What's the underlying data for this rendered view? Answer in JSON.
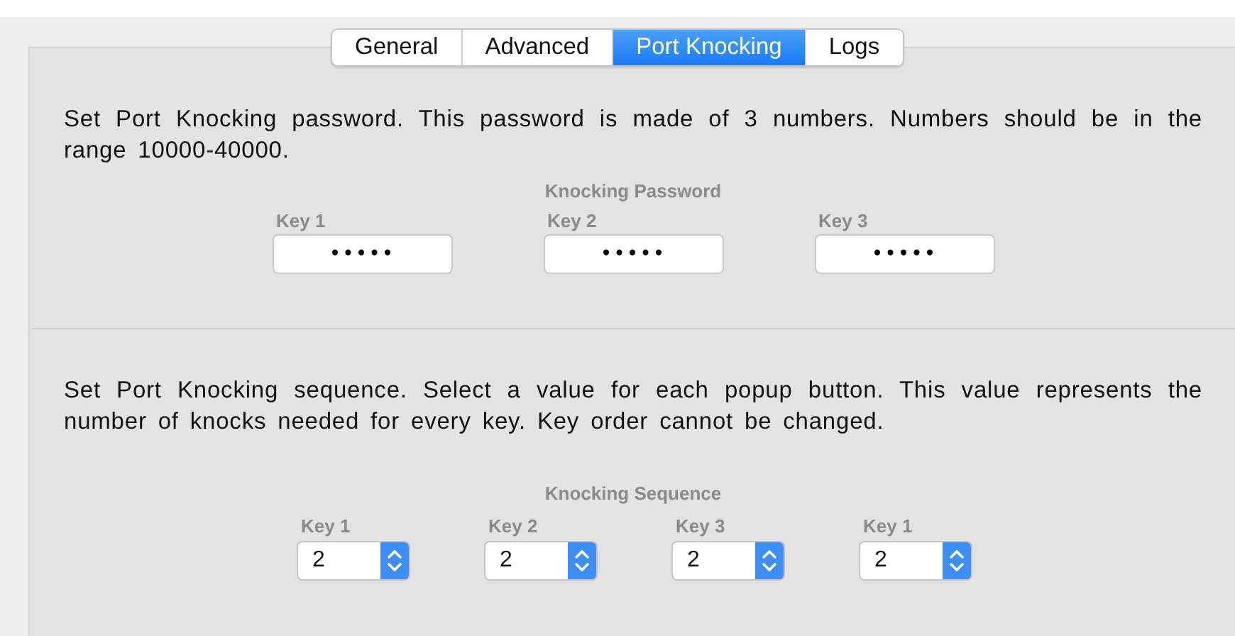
{
  "tabs": [
    {
      "label": "General",
      "selected": false
    },
    {
      "label": "Advanced",
      "selected": false
    },
    {
      "label": "Port Knocking",
      "selected": true
    },
    {
      "label": "Logs",
      "selected": false
    }
  ],
  "password_section": {
    "description": "Set Port Knocking password. This password is made of 3 numbers. Numbers should be in the range 10000-40000.",
    "heading": "Knocking Password",
    "fields": [
      {
        "label": "Key 1",
        "value": "•••••"
      },
      {
        "label": "Key 2",
        "value": "•••••"
      },
      {
        "label": "Key 3",
        "value": "•••••"
      }
    ]
  },
  "sequence_section": {
    "description": "Set Port Knocking sequence. Select a value for each popup button. This value represents the number of knocks needed for every key. Key order cannot be changed.",
    "heading": "Knocking Sequence",
    "popups": [
      {
        "label": "Key 1",
        "value": "2"
      },
      {
        "label": "Key 2",
        "value": "2"
      },
      {
        "label": "Key 3",
        "value": "2"
      },
      {
        "label": "Key 1",
        "value": "2"
      }
    ]
  }
}
